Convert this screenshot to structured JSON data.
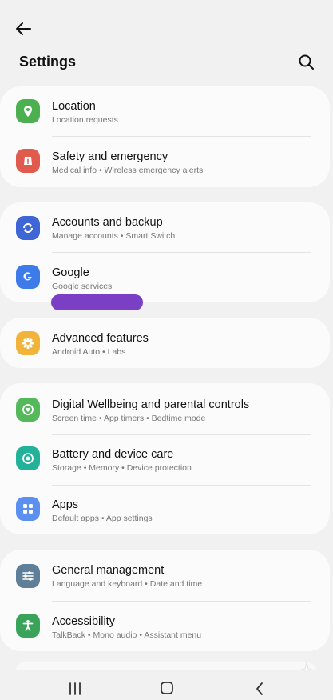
{
  "header": {
    "title": "Settings"
  },
  "colors": {
    "location": "#4caf50",
    "safety": "#e05a4e",
    "accounts": "#3e66d6",
    "google": "#3d7be8",
    "advanced": "#f2b33b",
    "wellbeing": "#55b85a",
    "battery": "#22b29a",
    "apps": "#5b8ff0",
    "general": "#5f7f99",
    "accessibility": "#3aa35a"
  },
  "items": {
    "location": {
      "label": "Location",
      "sub": "Location requests",
      "icon": "location-pin-icon"
    },
    "safety": {
      "label": "Safety and emergency",
      "sub": "Medical info  •  Wireless emergency alerts",
      "icon": "alert-icon"
    },
    "accounts": {
      "label": "Accounts and backup",
      "sub": "Manage accounts  •  Smart Switch",
      "icon": "sync-icon"
    },
    "google": {
      "label": "Google",
      "sub": "Google services",
      "icon": "google-icon"
    },
    "advanced": {
      "label": "Advanced features",
      "sub": "Android Auto  •  Labs",
      "icon": "gear-icon"
    },
    "wellbeing": {
      "label": "Digital Wellbeing and parental controls",
      "sub": "Screen time  •  App timers  •  Bedtime mode",
      "icon": "heart-icon"
    },
    "battery": {
      "label": "Battery and device care",
      "sub": "Storage  •  Memory  •  Device protection",
      "icon": "device-care-icon"
    },
    "apps": {
      "label": "Apps",
      "sub": "Default apps  •  App settings",
      "icon": "apps-grid-icon"
    },
    "general": {
      "label": "General management",
      "sub": "Language and keyboard  •  Date and time",
      "icon": "sliders-icon"
    },
    "accessibility": {
      "label": "Accessibility",
      "sub": "TalkBack  •  Mono audio  •  Assistant menu",
      "icon": "accessibility-icon"
    }
  }
}
